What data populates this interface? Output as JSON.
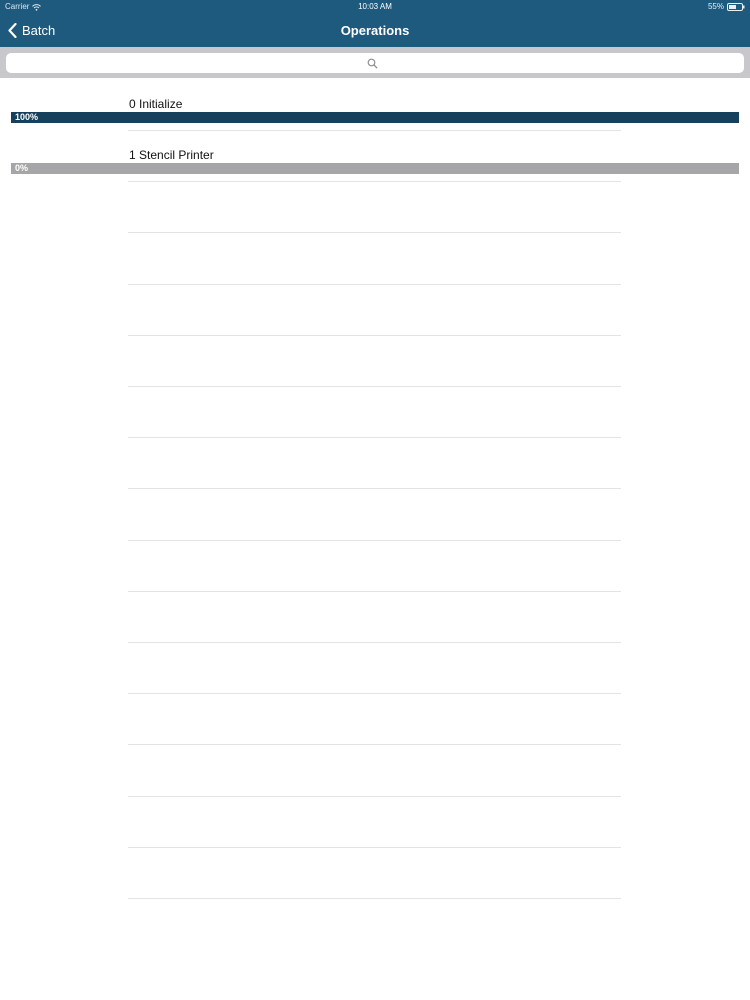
{
  "status_bar": {
    "carrier": "Carrier",
    "time": "10:03 AM",
    "battery": "55%"
  },
  "nav": {
    "back_label": "Batch",
    "title": "Operations"
  },
  "search": {
    "placeholder": ""
  },
  "operations": [
    {
      "label": "0 Initialize",
      "progress_text": "100%",
      "progress": 1.0
    },
    {
      "label": "1 Stencil Printer",
      "progress_text": "0%",
      "progress": 0.0
    }
  ],
  "colors": {
    "nav_background": "#1e5a7d",
    "progress_fill": "#17405c",
    "progress_track": "#a6a6a8",
    "search_background": "#c8c8cc"
  },
  "icons": {
    "back": "chevron-left-icon",
    "search": "search-icon",
    "wifi": "wifi-icon",
    "battery": "battery-icon"
  }
}
